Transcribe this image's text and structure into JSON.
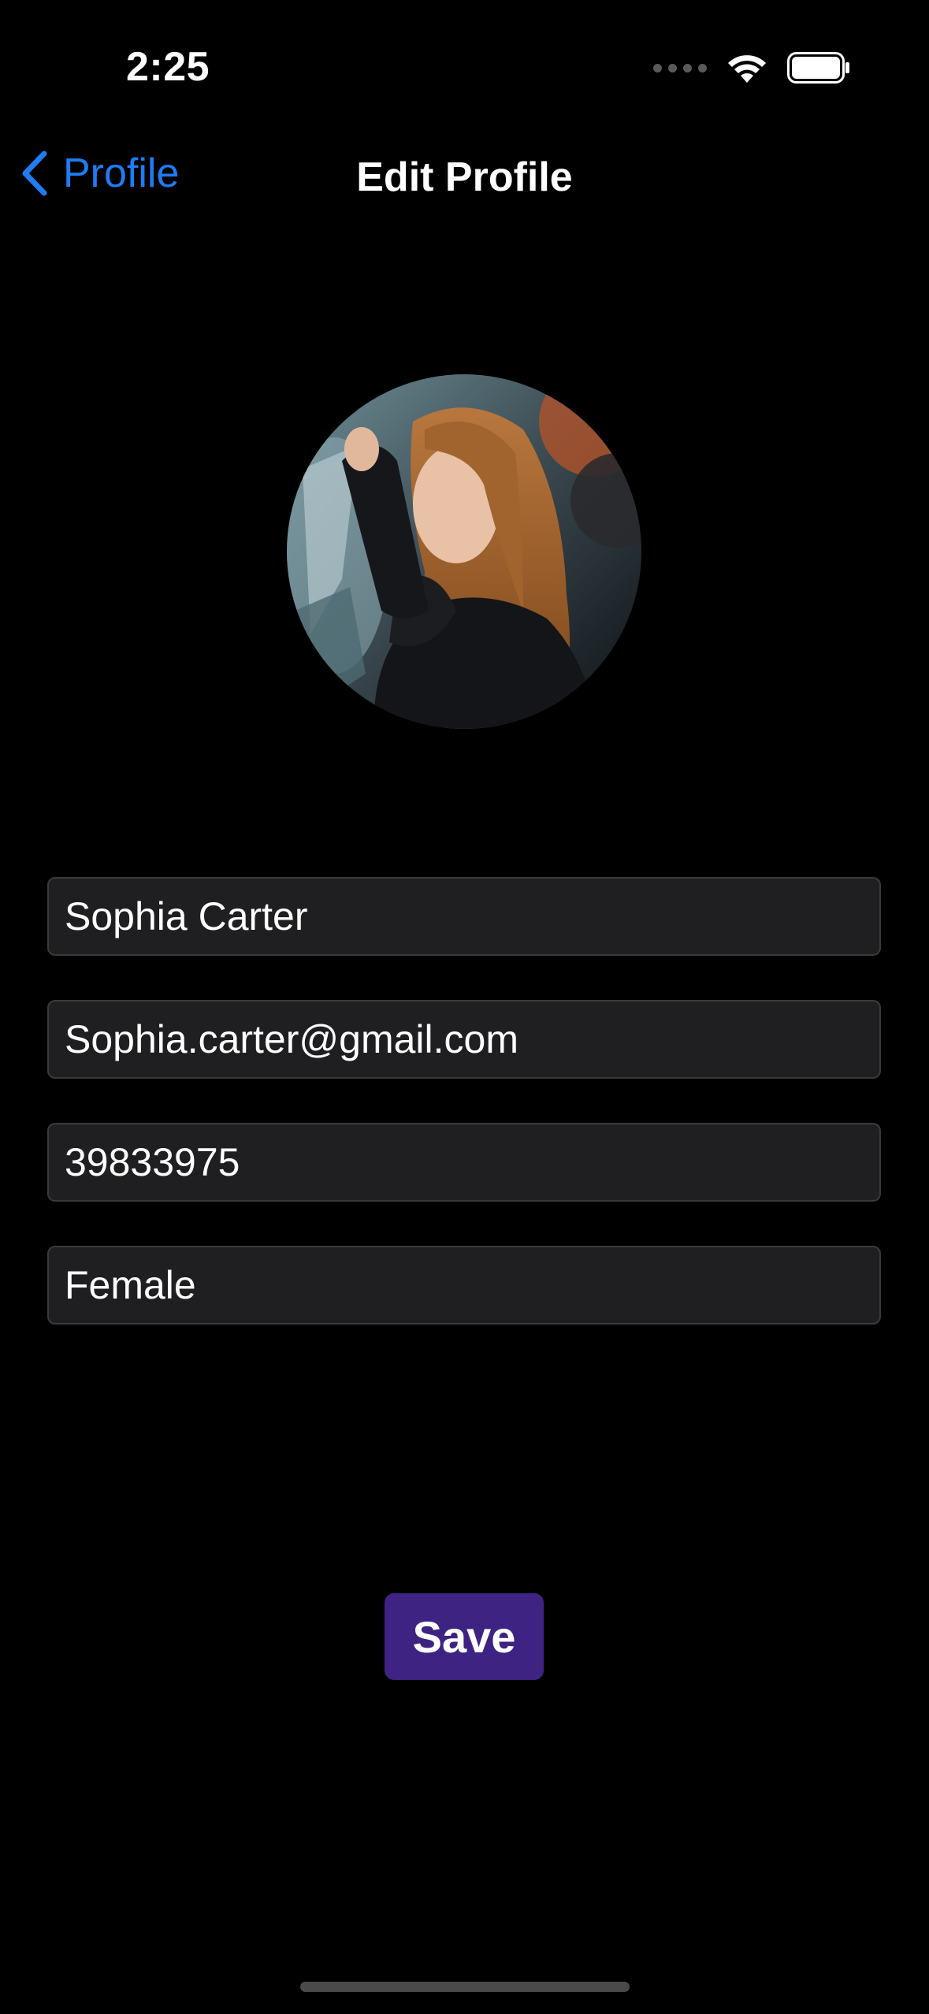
{
  "status_bar": {
    "time": "2:25",
    "icons": [
      "signal-dots-icon",
      "wifi-icon",
      "battery-icon"
    ]
  },
  "nav": {
    "back_label": "Profile",
    "back_icon": "chevron-left-icon",
    "title": "Edit Profile"
  },
  "avatar": {
    "icon": "profile-photo"
  },
  "form": {
    "name": "Sophia Carter",
    "email": "Sophia.carter@gmail.com",
    "phone": "39833975",
    "gender": "Female"
  },
  "save_button": {
    "label": "Save"
  },
  "colors": {
    "background": "#000000",
    "accent_blue": "#1f7cf2",
    "field_background": "#1f1f22",
    "save_button": "#3f2383"
  }
}
